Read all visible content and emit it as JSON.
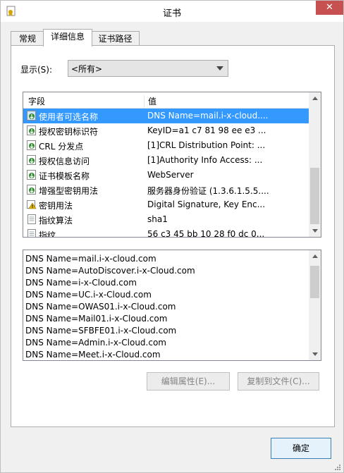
{
  "window": {
    "title": "证书",
    "close_glyph": "✕"
  },
  "tabs": [
    "常规",
    "详细信息",
    "证书路径"
  ],
  "show": {
    "label": "显示(S):",
    "value": "<所有>"
  },
  "fields_list": {
    "headers": [
      "字段",
      "值"
    ],
    "rows": [
      {
        "icon": "cert-field-icon",
        "field": "使用者可选名称",
        "value": "DNS Name=mail.i-x-cloud...."
      },
      {
        "icon": "cert-field-icon",
        "field": "授权密钥标识符",
        "value": "KeyID=a1 c7 81 98 ee e3 ..."
      },
      {
        "icon": "cert-field-icon",
        "field": "CRL 分发点",
        "value": "[1]CRL Distribution Point: ..."
      },
      {
        "icon": "cert-field-icon",
        "field": "授权信息访问",
        "value": "[1]Authority Info Access: ..."
      },
      {
        "icon": "cert-field-icon",
        "field": "证书模板名称",
        "value": "WebServer"
      },
      {
        "icon": "cert-field-icon",
        "field": "增强型密钥用法",
        "value": "服务器身份验证 (1.3.6.1.5.5...."
      },
      {
        "icon": "warning-field-icon",
        "field": "密钥用法",
        "value": "Digital Signature, Key Enc..."
      },
      {
        "icon": "document-field-icon",
        "field": "指纹算法",
        "value": "sha1"
      },
      {
        "icon": "document-field-icon",
        "field": "指纹",
        "value": "56 c3 45 bb 10 28 f0 dc 0..."
      }
    ]
  },
  "detail_lines": [
    "DNS Name=mail.i-x-cloud.com",
    "DNS Name=AutoDiscover.i-x-Cloud.com",
    "DNS Name=i-x-Cloud.com",
    "DNS Name=UC.i-x-Cloud.com",
    "DNS Name=OWAS01.i-x-Cloud.com",
    "DNS Name=Mail01.i-x-Cloud.com",
    "DNS Name=SFBFE01.i-x-Cloud.com",
    "DNS Name=Admin.i-x-Cloud.com",
    "DNS Name=Meet.i-x-Cloud.com"
  ],
  "buttons": {
    "edit_properties": "编辑属性(E)...",
    "copy_to_file": "复制到文件(C)...",
    "ok": "确定"
  },
  "colors": {
    "selection": "#3399ff",
    "close_button": "#c75050",
    "green_icon": "#2e8b2e",
    "warning_icon": "#e6b800"
  }
}
